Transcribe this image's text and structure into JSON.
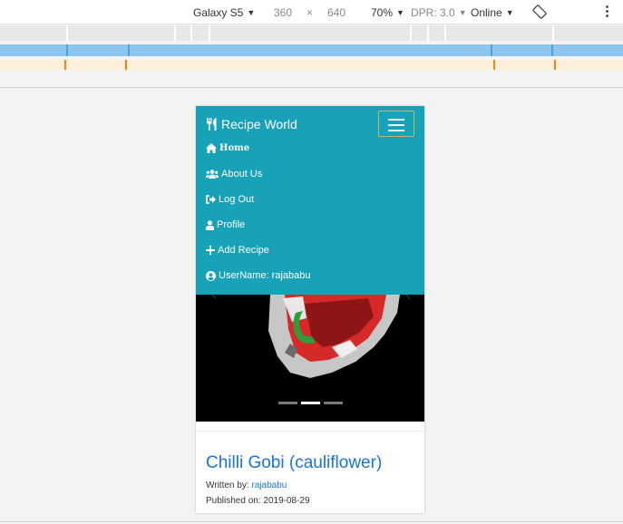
{
  "devtools": {
    "device": "Galaxy S5",
    "width": "360",
    "times": "×",
    "height": "640",
    "zoom": "70%",
    "dpr": "DPR: 3.0",
    "network": "Online"
  },
  "app": {
    "brand": "Recipe World",
    "nav": [
      {
        "label": "Home",
        "icon": "home-icon"
      },
      {
        "label": "About Us",
        "icon": "users-icon"
      },
      {
        "label": "Log Out",
        "icon": "sign-out-icon"
      },
      {
        "label": "Profile",
        "icon": "user-icon"
      },
      {
        "label": "Add Recipe",
        "icon": "plus-icon"
      },
      {
        "label": "UserName: rajababu",
        "icon": "user-circle-icon"
      }
    ],
    "carousel": {
      "slides": 3,
      "active_index": 1
    },
    "recipe": {
      "title": "Chilli Gobi (cauliflower)",
      "written_by_label": "Written by: ",
      "author": "rajababu",
      "published_label": "Published on: ",
      "published_date": "2019-08-29"
    }
  },
  "colors": {
    "navbar": "#17a2b8",
    "link": "#1a73d9"
  }
}
